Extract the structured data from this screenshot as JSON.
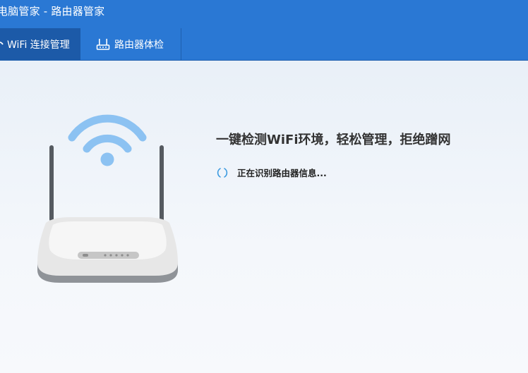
{
  "window": {
    "title": "电脑管家 - 路由器管家"
  },
  "tabs": [
    {
      "label": "WiFi 连接管理",
      "icon": "wifi-icon",
      "active": true
    },
    {
      "label": "路由器体检",
      "icon": "router-icon",
      "active": false
    }
  ],
  "main": {
    "headline": "一键检测WiFi环境，轻松管理，拒绝蹭网",
    "status": "正在识别路由器信息..."
  },
  "colors": {
    "titlebar": "#2a78d4",
    "active_tab": "#1c5aa8",
    "wifi_signal": "#8cc2f2",
    "spinner": "#3b9ae0",
    "headline_text": "#333333"
  }
}
